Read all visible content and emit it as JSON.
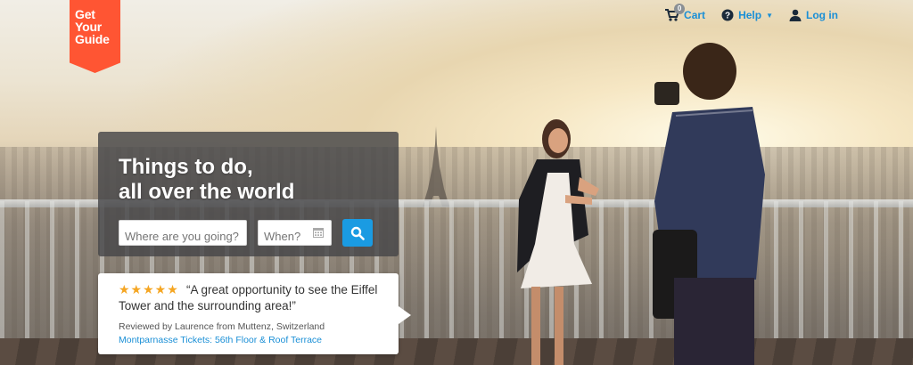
{
  "brand": {
    "logo_lines": [
      "Get",
      "Your",
      "Guide"
    ],
    "color": "#ff5533"
  },
  "nav": {
    "cart_count": "0",
    "cart_label": "Cart",
    "help_label": "Help",
    "login_label": "Log in",
    "accent": "#1a8fd6"
  },
  "hero": {
    "headline_line1": "Things to do,",
    "headline_line2": "all over the world"
  },
  "search": {
    "where_placeholder": "Where are you going?",
    "when_placeholder": "When?",
    "button_color": "#1a9be2"
  },
  "review": {
    "stars": "★★★★★",
    "quote": "“A great opportunity to see the Eiffel Tower and the surrounding area!”",
    "reviewer": "Reviewed by Laurence from Muttenz, Switzerland",
    "link_text": "Montparnasse Tickets: 56th Floor & Roof Terrace"
  }
}
